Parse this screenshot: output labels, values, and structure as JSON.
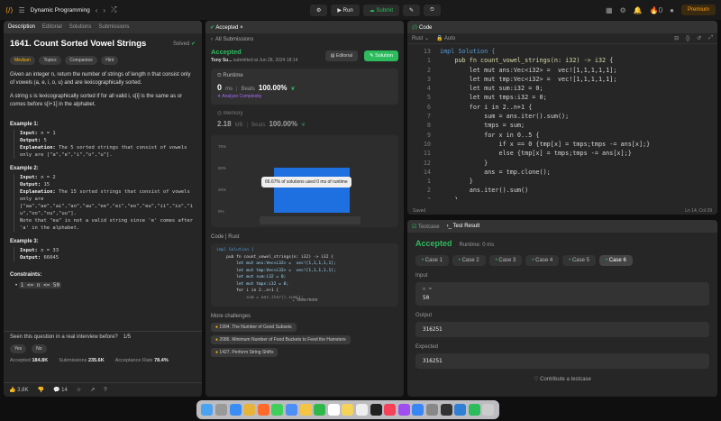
{
  "topbar": {
    "title": "Dynamic Programming",
    "run": "Run",
    "submit": "Submit",
    "premium": "Premium",
    "streak": "0"
  },
  "left": {
    "tabs": [
      "Description",
      "Editorial",
      "Solutions",
      "Submissions"
    ],
    "title": "1641. Count Sorted Vowel Strings",
    "status": "Solved",
    "tags": [
      "Medium",
      "Topics",
      "Companies",
      "Hint"
    ],
    "p1": "Given an integer n, return the number of strings of length n that consist only of vowels (a, e, i, o, u) and are lexicographically sorted.",
    "p2": "A string s is lexicographically sorted if for all valid i, s[i] is the same as or comes before s[i+1] in the alphabet.",
    "ex1_h": "Example 1:",
    "ex1_in": "n = 1",
    "ex1_out": "5",
    "ex1_exp": "The 5 sorted strings that consist of vowels only are [\"a\",\"e\",\"i\",\"o\",\"u\"].",
    "ex2_h": "Example 2:",
    "ex2_in": "n = 2",
    "ex2_out": "15",
    "ex2_exp": "The 15 sorted strings that consist of vowels only are",
    "ex2_list": "[\"aa\",\"ae\",\"ai\",\"ao\",\"au\",\"ee\",\"ei\",\"eo\",\"eu\",\"ii\",\"io\",\"iu\",\"oo\",\"ou\",\"uu\"].",
    "ex2_note": "Note that \"ea\" is not a valid string since 'e' comes after 'a' in the alphabet.",
    "ex3_h": "Example 3:",
    "ex3_in": "n = 33",
    "ex3_out": "66045",
    "constraints_h": "Constraints:",
    "constraint": "1 <= n <= 50",
    "interview_q": "Seen this question in a real interview before?",
    "interview_count": "1/5",
    "yes": "Yes",
    "no": "No",
    "accepted_label": "Accepted",
    "accepted_val": "184.8K",
    "subs_label": "Submissions",
    "subs_val": "235.6K",
    "rate_label": "Acceptance Rate",
    "rate_val": "78.4%",
    "likes": "3.8K",
    "comments": "14"
  },
  "mid": {
    "tab": "Accepted",
    "back": "All Submissions",
    "status": "Accepted",
    "user": "Tony Su...",
    "submitted": "submitted at Jun 28, 2024 18:14",
    "editorial": "Editorial",
    "solution": "Solution",
    "runtime_h": "Runtime",
    "runtime_val": "0",
    "runtime_unit": "ms",
    "beats": "Beats",
    "runtime_pct": "100.00%",
    "analyze": "Analyze Complexity",
    "memory_h": "Memory",
    "memory_val": "2.18",
    "memory_unit": "MB",
    "memory_pct": "100.00%",
    "tooltip": "66.67% of solutions used 0 ms of runtime",
    "yticks": [
      "75%",
      "50%",
      "25%",
      "0%"
    ],
    "code_h": "Code",
    "lang": "Rust",
    "view_more": "View more",
    "more_h": "More challenges",
    "challenges": [
      "1994. The Number of Good Subsets",
      "2086. Minimum Number of Food Buckets to Feed the Hamsters",
      "1427. Perform String Shifts"
    ]
  },
  "code": {
    "title": "Code",
    "lang": "Rust",
    "auto": "Auto",
    "saved": "Saved",
    "pos": "Ln 14, Col 29",
    "lines": [
      {
        "n": "13",
        "t": "impl Solution {"
      },
      {
        "n": "1",
        "t": "    pub fn count_vowel_strings(n: i32) -> i32 {"
      },
      {
        "n": "2",
        "t": "        let mut ans:Vec<i32> =  vec![1,1,1,1,1];"
      },
      {
        "n": "3",
        "t": "        let mut tmp:Vec<i32> =  vec![1,1,1,1,1];"
      },
      {
        "n": "4",
        "t": "        let mut sum:i32 = 0;"
      },
      {
        "n": "5",
        "t": "        let mut tmps:i32 = 0;"
      },
      {
        "n": "6",
        "t": "        for i in 2..n+1 {"
      },
      {
        "n": "7",
        "t": "            sum = ans.iter().sum();"
      },
      {
        "n": "8",
        "t": "            tmps = sum;"
      },
      {
        "n": "9",
        "t": "            for x in 0..5 {"
      },
      {
        "n": "10",
        "t": "                if x == 0 {tmp[x] = tmps;tmps -= ans[x];}"
      },
      {
        "n": "11",
        "t": "                else {tmp[x] = tmps;tmps -= ans[x];}"
      },
      {
        "n": "12",
        "t": "            }"
      },
      {
        "n": "14",
        "t": "            ans = tmp.clone();"
      },
      {
        "n": "1",
        "t": "        }"
      },
      {
        "n": "2",
        "t": "        ans.iter().sum()"
      },
      {
        "n": "3",
        "t": "    }"
      },
      {
        "n": "4",
        "t": "}"
      }
    ]
  },
  "test": {
    "tab1": "Testcase",
    "tab2": "Test Result",
    "status": "Accepted",
    "runtime": "Runtime: 0 ms",
    "cases": [
      "Case 1",
      "Case 2",
      "Case 3",
      "Case 4",
      "Case 5",
      "Case 6"
    ],
    "input_h": "Input",
    "input_var": "n =",
    "input_val": "50",
    "output_h": "Output",
    "output_val": "316251",
    "expected_h": "Expected",
    "expected_val": "316251",
    "contribute": "Contribute a testcase"
  }
}
